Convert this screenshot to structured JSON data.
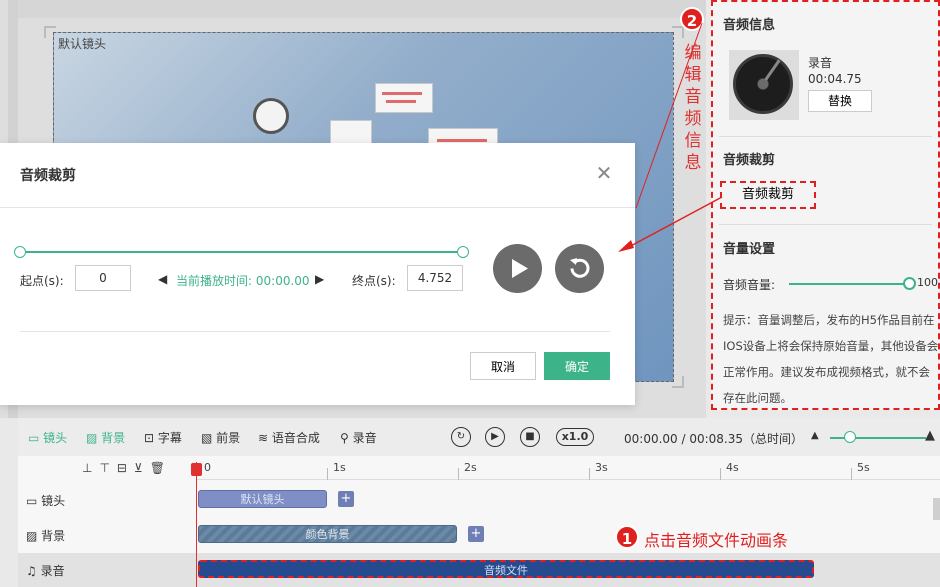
{
  "stage": {
    "canvas_label": "默认镜头"
  },
  "annotation_vertical": [
    "编",
    "辑",
    "音",
    "频",
    "信",
    "息"
  ],
  "badges": {
    "one": "1",
    "two": "2"
  },
  "panel": {
    "audio_info_title": "音频信息",
    "record_name": "录音",
    "record_duration": "00:04.75",
    "replace_label": "替换",
    "crop_title": "音频裁剪",
    "crop_button": "音频裁剪",
    "volume_title": "音量设置",
    "volume_label": "音频音量:",
    "volume_value": "100",
    "volume_level_percent": 100,
    "tip": "提示：音量调整后，发布的H5作品目前在IOS设备上将会保持原始音量，其他设备会正常作用。建议发布成视频格式，就不会存在此问题。"
  },
  "modal": {
    "title": "音频裁剪",
    "close_icon": "close-icon",
    "start_label": "起点(s):",
    "start_value": "0",
    "current_time_label": "当前播放时间:",
    "current_time_value": "00:00.00",
    "end_label": "终点(s):",
    "end_value": "4.752",
    "play_icon": "play-icon",
    "reset_icon": "reset-icon",
    "cancel": "取消",
    "confirm": "确定"
  },
  "toolbar": {
    "tools": [
      "镜头",
      "背景",
      "字幕",
      "前景",
      "语音合成",
      "录音"
    ],
    "speed": "x1.0",
    "time_readout": "00:00.00 / 00:08.35（总时间）"
  },
  "timeline": {
    "ticks": [
      "0",
      "1s",
      "2s",
      "3s",
      "4s",
      "5s"
    ],
    "tracks": [
      {
        "label": "镜头",
        "clip": "默认镜头"
      },
      {
        "label": "背景",
        "clip": "颜色背景"
      },
      {
        "label": "录音",
        "clip": "音频文件"
      }
    ],
    "plus": "+"
  },
  "annotation_bottom": "点击音频文件动画条",
  "colors": {
    "accent": "#3db38a",
    "annotation_red": "#e02020",
    "clip_blue": "#6f7fb5",
    "audio_clip": "#254a8f"
  }
}
